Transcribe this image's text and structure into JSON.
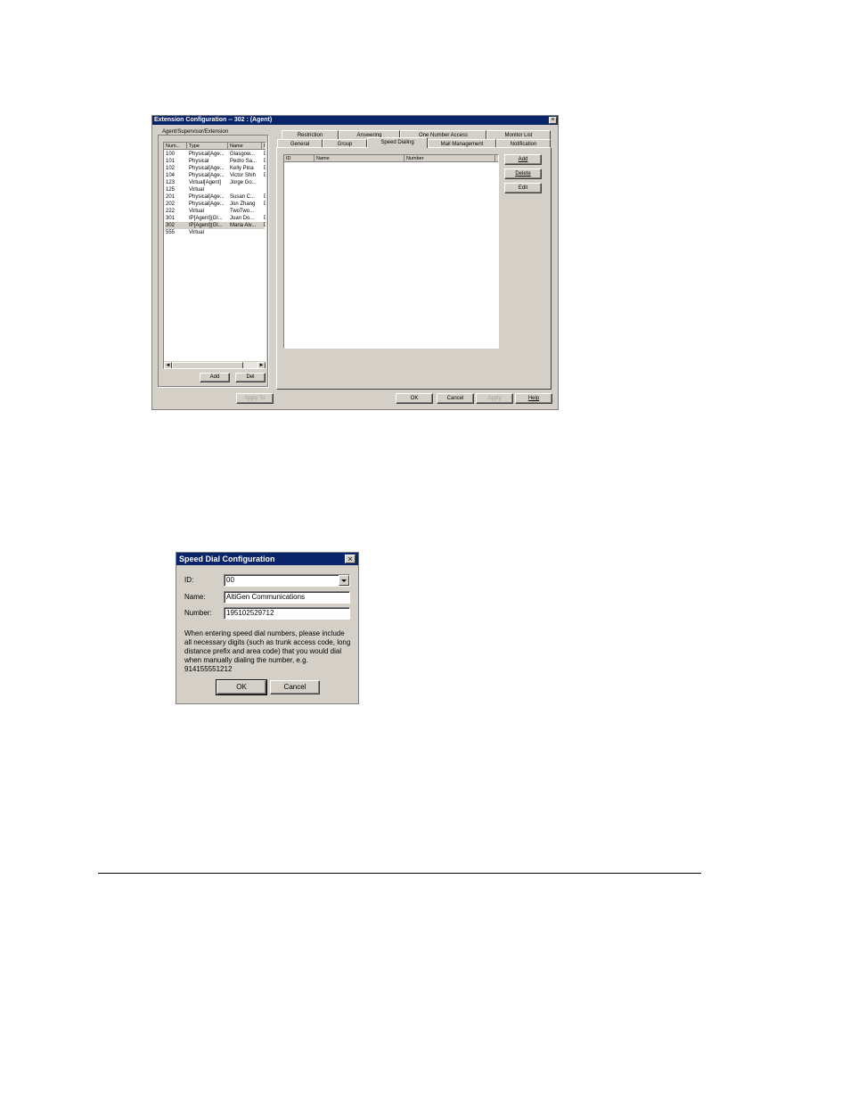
{
  "ext_window": {
    "title": "Extension Configuration -- 302 : (Agent)",
    "close_glyph": "×",
    "group_label": "Agent/Supervisor/Extension",
    "list_headers": [
      "Num...",
      "Type",
      "Name",
      "I"
    ],
    "list_rows": [
      {
        "num": "100",
        "type": "Physical[Age...",
        "name": "Glasgow...",
        "extra": "D"
      },
      {
        "num": "101",
        "type": "Physical",
        "name": "Pedro Sa...",
        "extra": "D"
      },
      {
        "num": "102",
        "type": "Physical[Age...",
        "name": "Kelly Pina",
        "extra": "D"
      },
      {
        "num": "104",
        "type": "Physical[Age...",
        "name": "Victor Shih",
        "extra": "D"
      },
      {
        "num": "123",
        "type": "Virtual[Agent]",
        "name": "Jorge Go...",
        "extra": ""
      },
      {
        "num": "125",
        "type": "Virtual",
        "name": "",
        "extra": ""
      },
      {
        "num": "201",
        "type": "Physical[Age...",
        "name": "Susan C...",
        "extra": "D"
      },
      {
        "num": "202",
        "type": "Physical[Age...",
        "name": "Jon Zhang",
        "extra": "D"
      },
      {
        "num": "222",
        "type": "Virtual",
        "name": "TwoTwo...",
        "extra": ""
      },
      {
        "num": "301",
        "type": "IP[Agent](Gl...",
        "name": "Juan Do...",
        "extra": "D"
      },
      {
        "num": "302",
        "type": "IP[Agent](Gl...",
        "name": "Maria Alv...",
        "extra": "D"
      },
      {
        "num": "555",
        "type": "Virtual",
        "name": "",
        "extra": ""
      }
    ],
    "scroll_left": "◄",
    "scroll_right": "►",
    "add_label": "Add",
    "del_label": "Del",
    "apply_to_label": "Apply To",
    "tabs_row1": [
      "Restriction",
      "Answering",
      "One Number Access",
      "Monitor List"
    ],
    "tabs_row2": [
      "General",
      "Group",
      "Speed Dialing",
      "Mail Management",
      "Notification"
    ],
    "active_tab": "Speed Dialing",
    "speed_headers": [
      "ID",
      "Name",
      "Number"
    ],
    "side_buttons": [
      "Add",
      "Delete",
      "Edit"
    ],
    "ok_label": "OK",
    "cancel_label": "Cancel",
    "apply_label": "Apply",
    "help_label": "Help"
  },
  "speed_dialog": {
    "title": "Speed Dial Configuration",
    "close_glyph": "×",
    "id_label": "ID:",
    "id_value": "00",
    "name_label": "Name:",
    "name_value": "AltiGen Communications",
    "number_label": "Number:",
    "number_value": "195102529712",
    "note": "When entering speed dial numbers, please include all necessary digits (such as trunk access code, long distance prefix and area code) that you would dial when manually dialing the number, e.g. 914155551212",
    "ok_label": "OK",
    "cancel_label": "Cancel"
  }
}
